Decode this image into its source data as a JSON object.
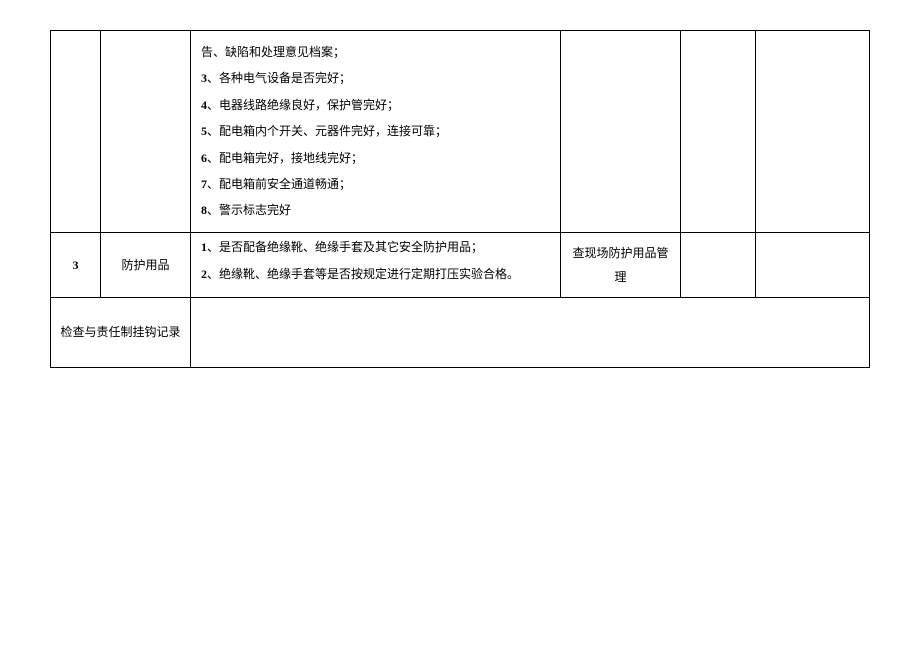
{
  "rows": [
    {
      "col1": "",
      "col2": "",
      "items": [
        {
          "num": "",
          "text": "告、缺陷和处理意见档案；"
        },
        {
          "num": "3",
          "text": "、各种电气设备是否完好；"
        },
        {
          "num": "4",
          "text": "、电器线路绝缘良好，保护管完好；"
        },
        {
          "num": "5",
          "text": "、配电箱内个开关、元器件完好，连接可靠；"
        },
        {
          "num": "6",
          "text": "、配电箱完好，接地线完好；"
        },
        {
          "num": "7",
          "text": "、配电箱前安全通道畅通；"
        },
        {
          "num": "8",
          "text": "、警示标志完好"
        }
      ],
      "col4": "",
      "col5": "",
      "col6": ""
    },
    {
      "col1": "3",
      "col2": "防护用品",
      "items": [
        {
          "num": "1",
          "text": "、是否配备绝缘靴、绝缘手套及其它安全防护用品；"
        },
        {
          "num": "2",
          "text": "、绝缘靴、绝缘手套等是否按规定进行定期打压实验合格。"
        }
      ],
      "col4": "查现场防护用品管理",
      "col5": "",
      "col6": ""
    }
  ],
  "footer": {
    "label": "检查与责任制挂钩记录",
    "content": ""
  }
}
